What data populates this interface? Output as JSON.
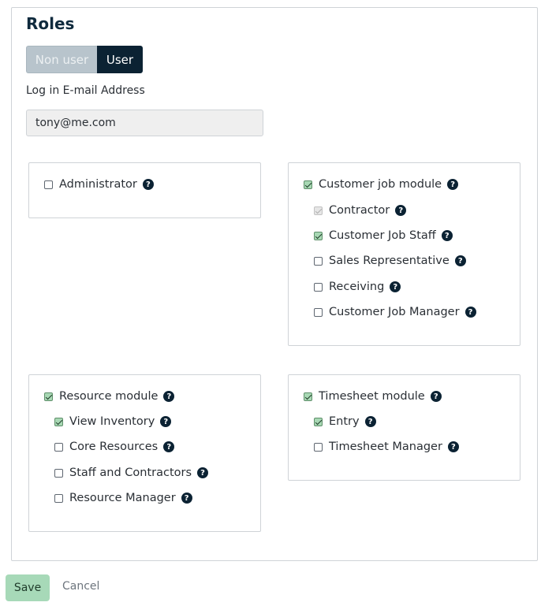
{
  "roles": {
    "title": "Roles",
    "toggle": {
      "off_label": "Non user",
      "on_label": "User",
      "selected": "User"
    },
    "email": {
      "label": "Log in E-mail Address",
      "value": "tony@me.com"
    }
  },
  "cards": {
    "administrator": {
      "label": "Administrator",
      "checked": false
    },
    "customer_job": {
      "label": "Customer job module",
      "checked": true,
      "items": [
        {
          "label": "Contractor",
          "checked": true,
          "disabled": true
        },
        {
          "label": "Customer Job Staff",
          "checked": true
        },
        {
          "label": "Sales Representative",
          "checked": false
        },
        {
          "label": "Receiving",
          "checked": false
        },
        {
          "label": "Customer Job Manager",
          "checked": false
        }
      ]
    },
    "resource": {
      "label": "Resource module",
      "checked": true,
      "items": [
        {
          "label": "View Inventory",
          "checked": true
        },
        {
          "label": "Core Resources",
          "checked": false
        },
        {
          "label": "Staff and Contractors",
          "checked": false
        },
        {
          "label": "Resource Manager",
          "checked": false
        }
      ]
    },
    "timesheet": {
      "label": "Timesheet module",
      "checked": true,
      "items": [
        {
          "label": "Entry",
          "checked": true
        },
        {
          "label": "Timesheet Manager",
          "checked": false
        }
      ]
    }
  },
  "help_glyph": "?",
  "actions": {
    "save_label": "Save",
    "cancel_label": "Cancel"
  }
}
